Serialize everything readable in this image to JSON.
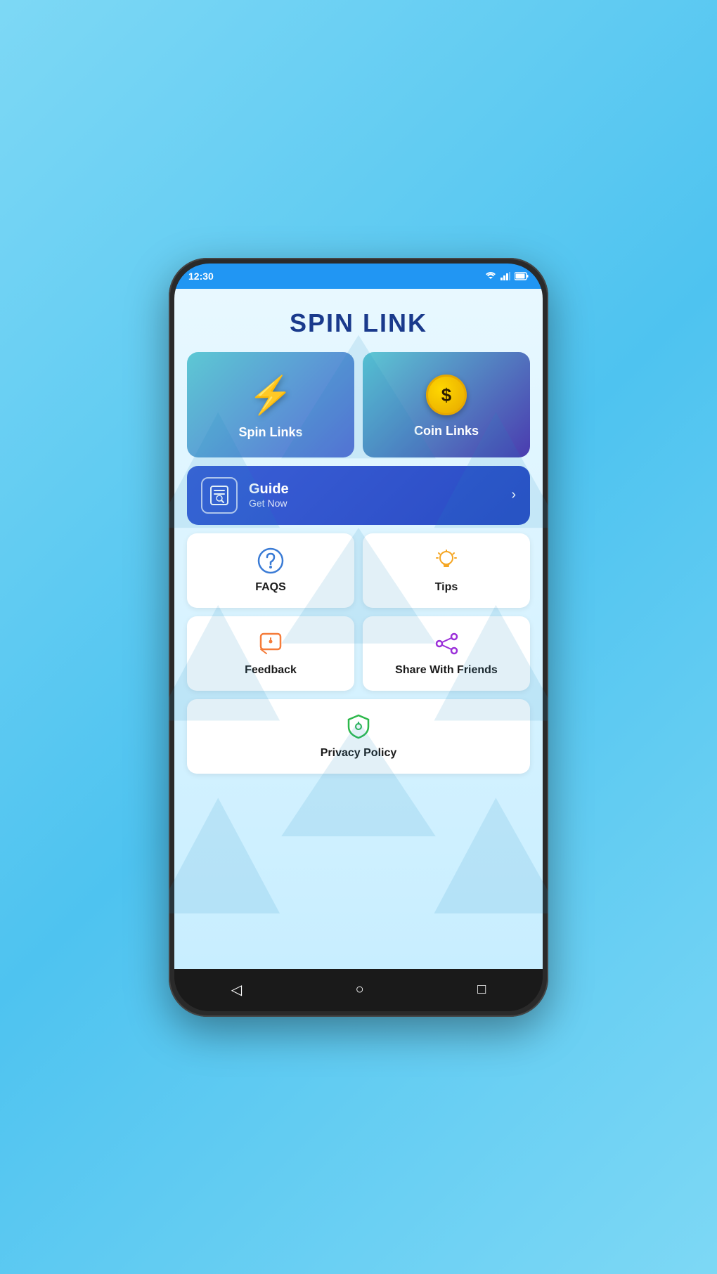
{
  "meta": {
    "bg_color": "#5ec9f0",
    "screen_bg_top": "#e8f8ff",
    "screen_bg_bot": "#c8eeff"
  },
  "status_bar": {
    "time": "12:30",
    "bg": "#2196f3"
  },
  "app": {
    "title": "SPIN LINK"
  },
  "cards": {
    "spin_links": {
      "label": "Spin Links",
      "icon": "⚡"
    },
    "coin_links": {
      "label": "Coin Links",
      "symbol": "$"
    },
    "guide": {
      "title": "Guide",
      "subtitle": "Get Now"
    },
    "faqs": {
      "label": "FAQS"
    },
    "tips": {
      "label": "Tips"
    },
    "feedback": {
      "label": "Feedback"
    },
    "share": {
      "label": "Share With Friends"
    },
    "privacy": {
      "label": "Privacy Policy"
    }
  },
  "nav": {
    "back": "◁",
    "home": "○",
    "recent": "□"
  }
}
